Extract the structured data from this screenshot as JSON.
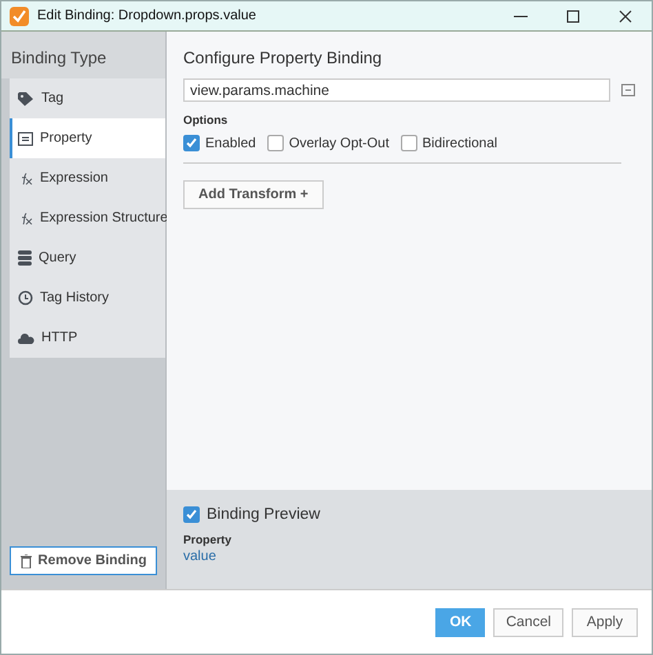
{
  "window": {
    "title": "Edit Binding: Dropdown.props.value"
  },
  "sidebar": {
    "heading": "Binding Type",
    "items": [
      {
        "label": "Tag",
        "kind": "tag",
        "selected": false
      },
      {
        "label": "Property",
        "kind": "property",
        "selected": true
      },
      {
        "label": "Expression",
        "kind": "expression",
        "selected": false
      },
      {
        "label": "Expression Structure",
        "kind": "expression",
        "selected": false
      },
      {
        "label": "Query",
        "kind": "query",
        "selected": false
      },
      {
        "label": "Tag History",
        "kind": "history",
        "selected": false
      },
      {
        "label": "HTTP",
        "kind": "http",
        "selected": false
      }
    ],
    "remove_button": "Remove Binding"
  },
  "config": {
    "title": "Configure Property Binding",
    "path": "view.params.machine",
    "options_label": "Options",
    "options": [
      {
        "label": "Enabled",
        "checked": true
      },
      {
        "label": "Overlay Opt-Out",
        "checked": false
      },
      {
        "label": "Bidirectional",
        "checked": false
      }
    ],
    "add_transform": "Add Transform +"
  },
  "preview": {
    "label": "Binding Preview",
    "checked": true,
    "field_label": "Property",
    "value": "value"
  },
  "buttons": [
    {
      "label": "OK",
      "primary": true
    },
    {
      "label": "Cancel",
      "primary": false
    },
    {
      "label": "Apply",
      "primary": false
    }
  ]
}
